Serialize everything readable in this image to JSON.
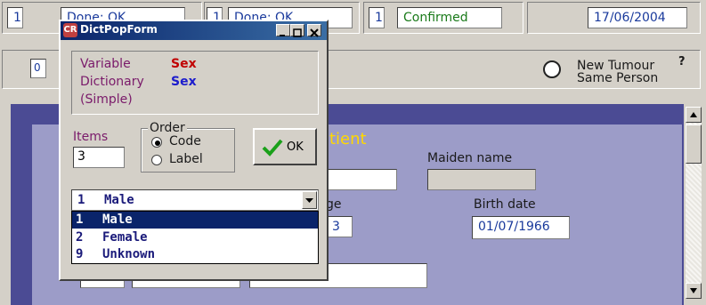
{
  "top_row": {
    "box1_num": "1",
    "box1_status": "Done: OK",
    "box2_num": "1",
    "box2_status": "Done: OK",
    "box3_num": "1",
    "box3_status": "Confirmed",
    "date": "17/06/2004"
  },
  "second_row": {
    "small_num": "0",
    "new_tumour_line1": "New Tumour",
    "new_tumour_line2": "Same Person",
    "help": "?"
  },
  "background_form": {
    "title_fragment": "tient",
    "maiden_name_label": "Maiden name",
    "age_label_fragment": "ge",
    "age_value_fragment": "3",
    "birth_date_label": "Birth date",
    "birth_date_value": "01/07/1966"
  },
  "dialog": {
    "title": "DictPopForm",
    "variable_label": "Variable",
    "variable_value": "Sex",
    "dictionary_label": "Dictionary",
    "dictionary_value": "Sex",
    "simple_label": "(Simple)",
    "items_label": "Items",
    "items_value": "3",
    "order_label": "Order",
    "order_code": "Code",
    "order_label_opt": "Label",
    "ok_label": "OK",
    "selected_code": "1",
    "selected_label": "Male",
    "options": [
      {
        "code": "1",
        "label": "Male"
      },
      {
        "code": "2",
        "label": "Female"
      },
      {
        "code": "9",
        "label": "Unknown"
      }
    ],
    "colors": {
      "title_bar": "#0a246a",
      "variable_value": "#c00000",
      "dictionary_value": "#1c1ccc",
      "label_text": "#7a1a6a",
      "ok_check": "#1aa01a"
    }
  }
}
